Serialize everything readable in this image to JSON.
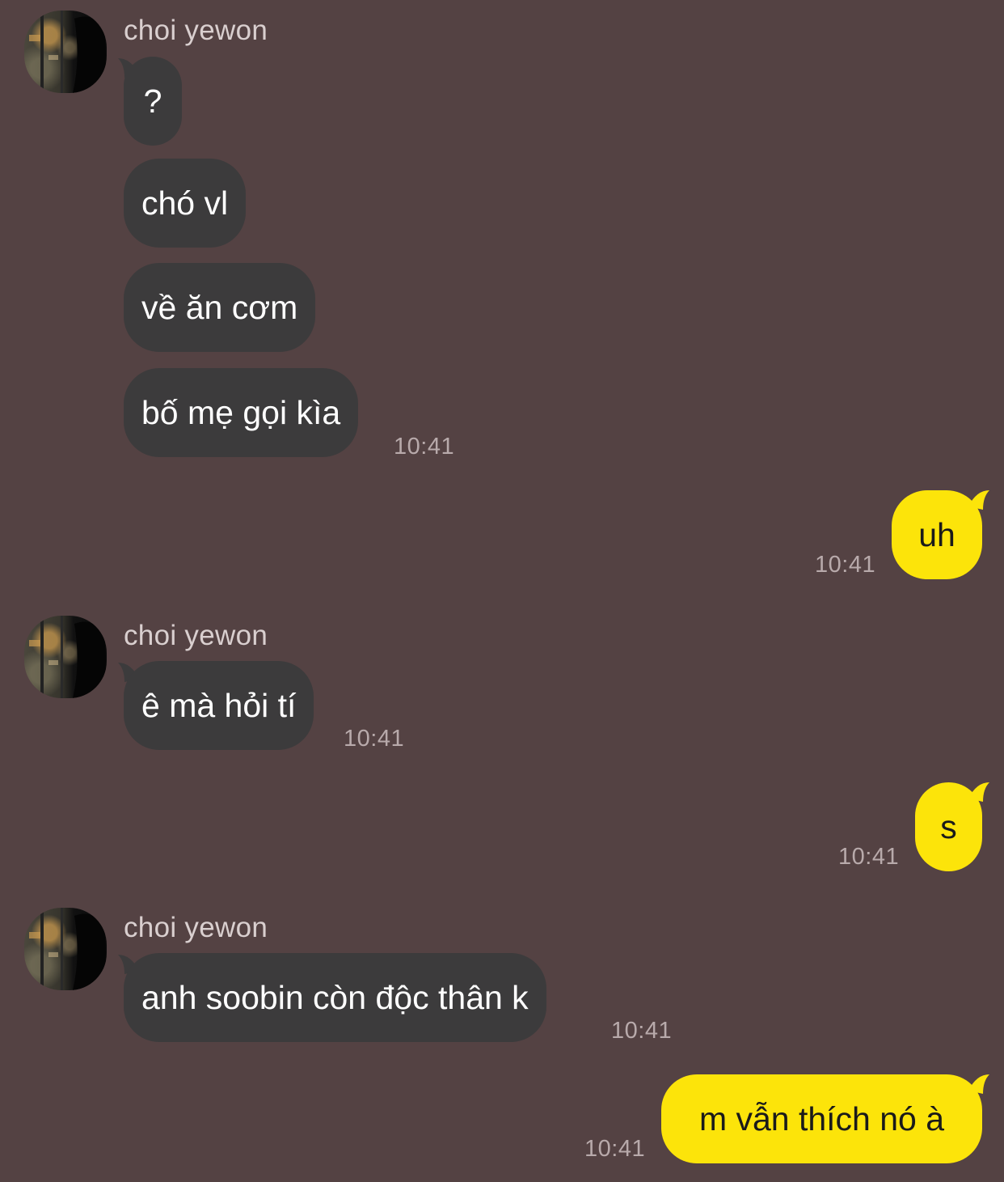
{
  "chat": {
    "contact_name": "choi yewon",
    "groups": [
      {
        "sender": "choi yewon",
        "messages": [
          "?",
          "chó vl",
          "về ăn cơm",
          "bố mẹ gọi kìa"
        ],
        "time": "10:41"
      },
      {
        "me": true,
        "messages": [
          "uh"
        ],
        "time": "10:41"
      },
      {
        "sender": "choi yewon",
        "messages": [
          "ê mà hỏi tí"
        ],
        "time": "10:41"
      },
      {
        "me": true,
        "messages": [
          "s"
        ],
        "time": "10:41"
      },
      {
        "sender": "choi yewon",
        "messages": [
          "anh soobin còn độc thân k"
        ],
        "time": "10:41"
      },
      {
        "me": true,
        "messages": [
          "m vẫn thích nó à"
        ],
        "time": "10:41"
      }
    ]
  },
  "colors": {
    "background": "#544243",
    "incoming_bubble": "#3c3b3c",
    "outgoing_bubble": "#fce40a",
    "sender_text": "#d9cfcf",
    "time_text": "#b8aaab"
  },
  "icons": {
    "avatar": "profile-photo"
  }
}
